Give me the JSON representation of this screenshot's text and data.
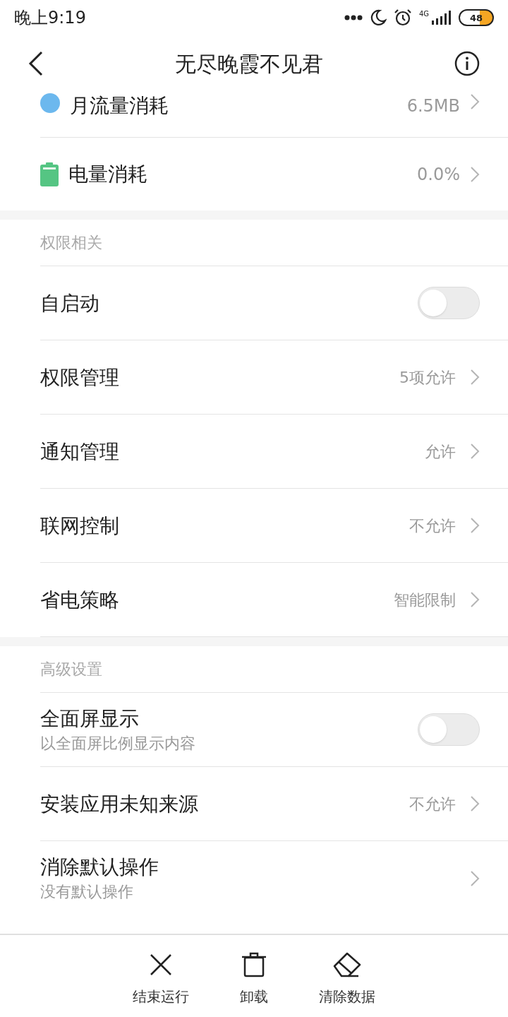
{
  "status_bar": {
    "time": "晚上9:19",
    "network": "4G",
    "battery": "48"
  },
  "header": {
    "title": "无尽晚霞不见君"
  },
  "usage_rows": [
    {
      "kind": "data",
      "label": "月流量消耗",
      "value": "6.5MB"
    },
    {
      "kind": "battery",
      "label": "电量消耗",
      "value": "0.0%"
    }
  ],
  "sections": [
    {
      "title": "权限相关",
      "rows": [
        {
          "kind": "toggle",
          "label": "自启动",
          "on": false
        },
        {
          "kind": "link",
          "label": "权限管理",
          "value": "5项允许"
        },
        {
          "kind": "link",
          "label": "通知管理",
          "value": "允许"
        },
        {
          "kind": "link",
          "label": "联网控制",
          "value": "不允许"
        },
        {
          "kind": "link",
          "label": "省电策略",
          "value": "智能限制"
        }
      ]
    },
    {
      "title": "高级设置",
      "rows": [
        {
          "kind": "toggle",
          "label": "全面屏显示",
          "subtitle": "以全面屏比例显示内容",
          "on": false
        },
        {
          "kind": "link",
          "label": "安装应用未知来源",
          "value": "不允许"
        },
        {
          "kind": "link",
          "label": "消除默认操作",
          "subtitle": "没有默认操作"
        }
      ]
    }
  ],
  "bottom_actions": [
    {
      "kind": "close",
      "label": "结束运行"
    },
    {
      "kind": "trash",
      "label": "卸载"
    },
    {
      "kind": "eraser",
      "label": "清除数据"
    }
  ]
}
